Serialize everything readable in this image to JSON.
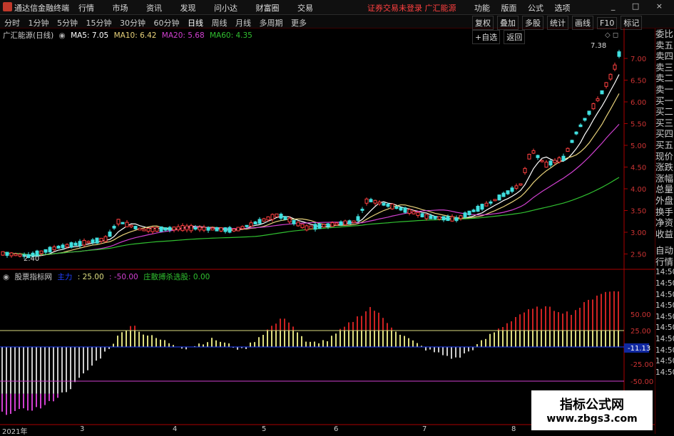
{
  "topbar": {
    "app_title": "通达信金融终端",
    "menu": [
      "行情",
      "市场",
      "资讯",
      "发现",
      "问小达",
      "财富圈",
      "交易"
    ],
    "status": "证券交易未登录  广汇能源",
    "sys": [
      "功能",
      "版面",
      "公式",
      "选项"
    ],
    "win": "_ □ ×"
  },
  "periodbar": {
    "items": [
      "分时",
      "1分钟",
      "5分钟",
      "15分钟",
      "30分钟",
      "60分钟",
      "日线",
      "周线",
      "月线",
      "多周期",
      "更多"
    ],
    "active": "日线",
    "tools": [
      "复权",
      "叠加",
      "多股",
      "统计",
      "画线",
      "F10",
      "标记",
      "+自选",
      "返回"
    ]
  },
  "price_panel": {
    "title": "广汇能源(日线)",
    "ma": [
      {
        "label": "MA5: 7.05",
        "color": "#ffffff"
      },
      {
        "label": "MA10: 6.42",
        "color": "#e8d27a"
      },
      {
        "label": "MA20: 5.68",
        "color": "#d040d0"
      },
      {
        "label": "MA60: 4.35",
        "color": "#30c030"
      }
    ],
    "high_label": "7.38",
    "low_label": "2.40",
    "y_ticks": [
      "7.00",
      "6.50",
      "6.00",
      "5.50",
      "5.00",
      "4.50",
      "4.00",
      "3.50",
      "3.00",
      "2.50"
    ]
  },
  "indicator_panel": {
    "title": "股票指标网",
    "items": [
      {
        "label": "主力",
        "color": "#2040ff"
      },
      {
        "label": ": 25.00",
        "color": "#dddd80"
      },
      {
        "label": ": -50.00",
        "color": "#d040d0"
      },
      {
        "label": "庄散搏杀选股: 0.00",
        "color": "#30c030"
      }
    ],
    "y_ticks": [
      "50.00",
      "25.00",
      "-25.00",
      "-50.00"
    ],
    "current": "-11.13"
  },
  "right_panel": [
    "委比",
    "卖五",
    "卖四",
    "卖三",
    "卖二",
    "卖一",
    "买一",
    "买二",
    "买三",
    "买四",
    "买五",
    "现价",
    "涨跌",
    "涨幅",
    "总量",
    "外盘",
    "换手",
    "净资",
    "收益",
    "自动",
    "行情",
    "14:50",
    "14:50",
    "14:50",
    "14:50",
    "14:50",
    "14:50",
    "14:50",
    "14:50",
    "14:50",
    "14:50"
  ],
  "x_axis": [
    "2021年",
    "3",
    "4",
    "5",
    "6",
    "7",
    "8"
  ],
  "watermark": {
    "line1": "指标公式网",
    "line2": "www.zbgs3.com"
  }
}
